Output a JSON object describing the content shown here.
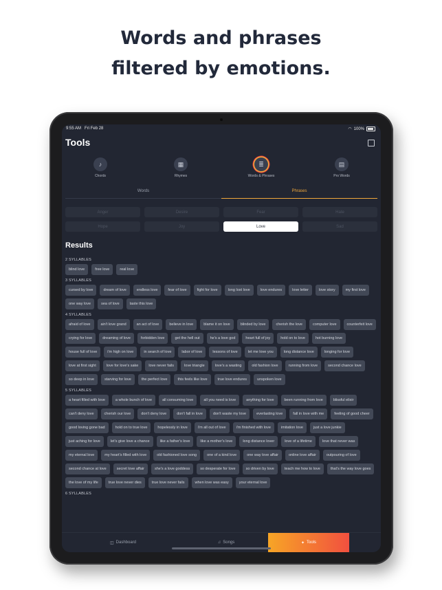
{
  "headline": [
    "Words and phrases",
    "filtered by emotions."
  ],
  "status": {
    "time": "9:55 AM",
    "date": "Fri Feb 28",
    "battery": "100%"
  },
  "page_title": "Tools",
  "tools": [
    {
      "label": "Chords",
      "icon": "chords-icon",
      "glyph": "♪",
      "active": false
    },
    {
      "label": "Rhymes",
      "icon": "rhymes-icon",
      "glyph": "▦",
      "active": false
    },
    {
      "label": "Words & Phrases",
      "icon": "words-phrases-icon",
      "glyph": "≣",
      "active": true
    },
    {
      "label": "Pro Words",
      "icon": "pro-words-icon",
      "glyph": "▤",
      "active": false
    }
  ],
  "segment_tabs": [
    {
      "label": "Words",
      "active": false
    },
    {
      "label": "Phrases",
      "active": true
    }
  ],
  "emotions": [
    {
      "label": "Anger",
      "active": false
    },
    {
      "label": "Desire",
      "active": false
    },
    {
      "label": "Fear",
      "active": false
    },
    {
      "label": "Hate",
      "active": false
    },
    {
      "label": "Hope",
      "active": false
    },
    {
      "label": "Joy",
      "active": false
    },
    {
      "label": "Love",
      "active": true
    },
    {
      "label": "Sad",
      "active": false
    }
  ],
  "results_title": "Results",
  "groups": [
    {
      "heading": "2 SYLLABLES",
      "phrases": [
        "blind love",
        "free love",
        "real love"
      ]
    },
    {
      "heading": "3 SYLLABLES",
      "phrases": [
        "cursed by love",
        "dream of love",
        "endless love",
        "fear of love",
        "fight for love",
        "long lost love",
        "love endures",
        "love letter",
        "love story",
        "my first love",
        "one way love",
        "sea of love",
        "taste this love"
      ]
    },
    {
      "heading": "4 SYLLABLES",
      "phrases": [
        "afraid of love",
        "ain't love grand",
        "an act of love",
        "believe in love",
        "blame it on love",
        "blinded by love",
        "cherish the love",
        "computer love",
        "counterfeit love",
        "crying for love",
        "dreaming of love",
        "forbidden love",
        "get the hell out",
        "he's a love god",
        "heart full of joy",
        "hold on to love",
        "hot burning love",
        "house full of love",
        "i'm high on love",
        "in search of love",
        "labor of love",
        "lessons of love",
        "let me love you",
        "long distance love",
        "longing for love",
        "love at first sight",
        "love for love's sake",
        "love never fails",
        "love triangle",
        "love's a wasting",
        "old fashion love",
        "running from love",
        "second chance love",
        "so deep in love",
        "starving for love",
        "the perfect love",
        "this feels like love",
        "true love endures",
        "unspoken love"
      ]
    },
    {
      "heading": "5 SYLLABLES",
      "phrases": [
        "a heart filled with love",
        "a whole bunch of love",
        "all consuming love",
        "all you need is love",
        "anything for love",
        "been running from love",
        "blissful elixir",
        "can't deny love",
        "cherish our love",
        "don't deny love",
        "don't fall in love",
        "don't waste my love",
        "everlasting love",
        "fall in love with me",
        "feeling of good cheer",
        "good loving gone bad",
        "hold on to true love",
        "hopelessly in love",
        "i'm all out of love",
        "i'm finished with love",
        "imitation love",
        "just a love junkie",
        "just aching for love",
        "let's give love a chance",
        "like a father's love",
        "like a mother's love",
        "long distance lover",
        "love of a lifetime",
        "love that never was",
        "my eternal love",
        "my heart's filled with love",
        "old fashioned love song",
        "one of a kind love",
        "one way love affair",
        "online love affair",
        "outpouring of love",
        "second chance at love",
        "secret love affair",
        "she's a love goddess",
        "so desperate for love",
        "so driven by love",
        "teach me how to love",
        "that's the way love goes",
        "the love of my life",
        "true love never dies",
        "true love never fails",
        "when love was easy",
        "your eternal love"
      ]
    },
    {
      "heading": "6 SYLLABLES",
      "phrases": []
    }
  ],
  "tabbar": [
    {
      "label": "Dashboard",
      "icon": "dashboard-icon",
      "glyph": "◫",
      "active": false
    },
    {
      "label": "Songs",
      "icon": "songs-icon",
      "glyph": "♫",
      "active": false
    },
    {
      "label": "Tools",
      "icon": "tools-icon",
      "glyph": "✦",
      "active": true
    }
  ]
}
